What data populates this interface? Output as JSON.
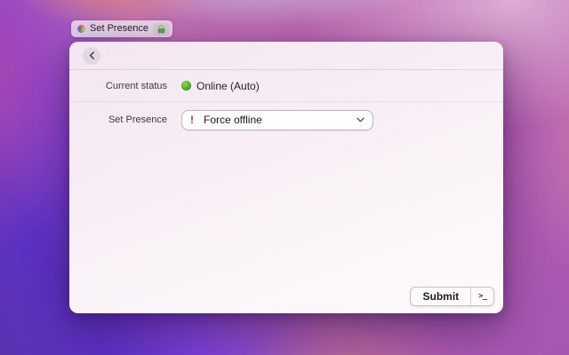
{
  "tab": {
    "title": "Set Presence"
  },
  "window": {
    "form": {
      "current_status": {
        "label": "Current status",
        "value": "Online (Auto)",
        "status": "online"
      },
      "set_presence": {
        "label": "Set Presence",
        "selected_option": "Force offline",
        "warning_glyph": "!"
      }
    },
    "footer": {
      "submit_label": "Submit",
      "terminal_glyph": ">_"
    }
  },
  "colors": {
    "status_online_green": "#4bb11d",
    "warning_red": "#dd2a27",
    "lock_green": "#6ba35c",
    "wallpaper_violet": "#5c32c4",
    "wallpaper_magenta": "#b65fae"
  }
}
